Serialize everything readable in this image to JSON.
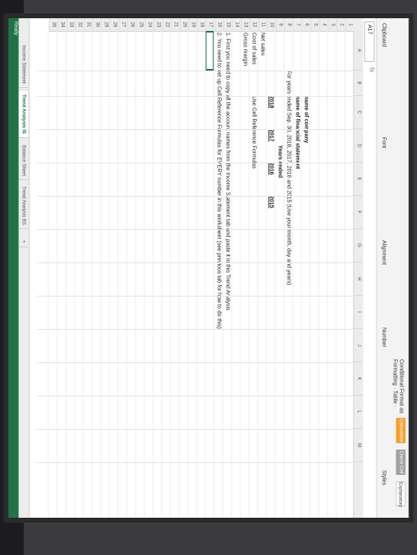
{
  "ribbon": {
    "clipboard_label": "Clipboard",
    "font_label": "Font",
    "alignment_label": "Alignment",
    "number_label": "Number",
    "conditional_label": "Conditional Format as",
    "formatting_label": "Formatting · Table ·",
    "styles_label": "Styles",
    "cell_styles": [
      {
        "label": "Calculation",
        "color": "#f0a030"
      },
      {
        "label": "Check Cell",
        "color": "#a0a0a0"
      },
      {
        "label": "Explanatory",
        "color": "#ffffff"
      }
    ]
  },
  "formula_bar": {
    "name_box": "A17",
    "fx": "fx"
  },
  "columns": [
    "A",
    "B",
    "C",
    "D",
    "E",
    "F",
    "G",
    "H",
    "I",
    "J",
    "K",
    "L",
    "M"
  ],
  "rows": [
    "1",
    "2",
    "3",
    "4",
    "5",
    "6",
    "7",
    "8",
    "9",
    "10",
    "11",
    "12",
    "13",
    "14",
    "15",
    "16",
    "17",
    "18",
    "19",
    "20",
    "21",
    "22",
    "23",
    "24",
    "25",
    "26",
    "27",
    "28",
    "29",
    "30",
    "31",
    "32",
    "33",
    "34",
    "35"
  ],
  "cells": {
    "company": "name of company",
    "statement": "name of financial statement",
    "period": "For years ended Sep. 30, 2018, 2017, 2016 and 2015 (Use your month, day and years)",
    "years_ended": "Years ended",
    "y2018": "2018",
    "y2017": "2017",
    "y2016": "2016",
    "y2015": "2015",
    "net_sales": "Net sales",
    "cost_of_sales": "Cost of sales",
    "gross_margin": "Gross margin",
    "use_formulas": "Use Cell Reference Formulas",
    "instr1": "1. First you need to copy all the account names from the Income Statement tab and paste it in this Trend Analysis",
    "instr2": "2. You need to set up Cell Reference Formulas for EVERY number in this worksheet (see previous tab for how to do this)"
  },
  "tabs": [
    {
      "label": "Income Statement",
      "active": false
    },
    {
      "label": "Trend Analysis IS",
      "active": true
    },
    {
      "label": "Balance Sheet",
      "active": false
    },
    {
      "label": "Trend Analysis BS",
      "active": false
    }
  ],
  "add_sheet": "+",
  "status": {
    "ready": "Ready"
  },
  "colors": {
    "excel_green": "#217346"
  }
}
